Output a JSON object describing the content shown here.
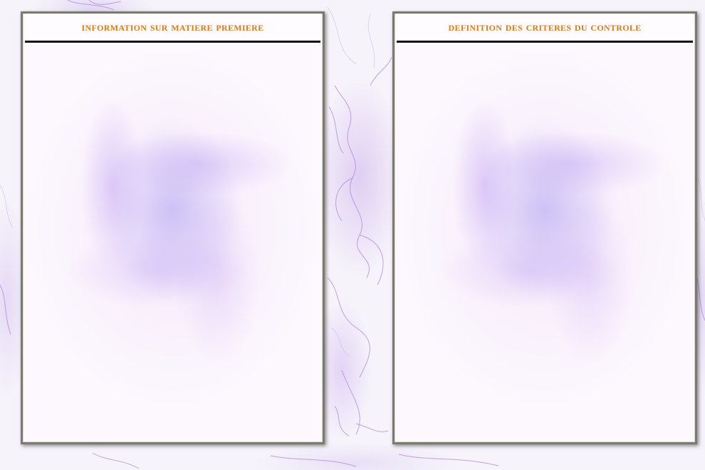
{
  "background": {
    "style": "white-lilac-marble",
    "vein_color": "#a070d8"
  },
  "panels": [
    {
      "title": "INFORMATION SUR MATIERE PREMIERE",
      "title_color": "#e07a10"
    },
    {
      "title": "DEFINITION DES CRITERES DU CONTROLE",
      "title_color": "#e07a10"
    }
  ]
}
